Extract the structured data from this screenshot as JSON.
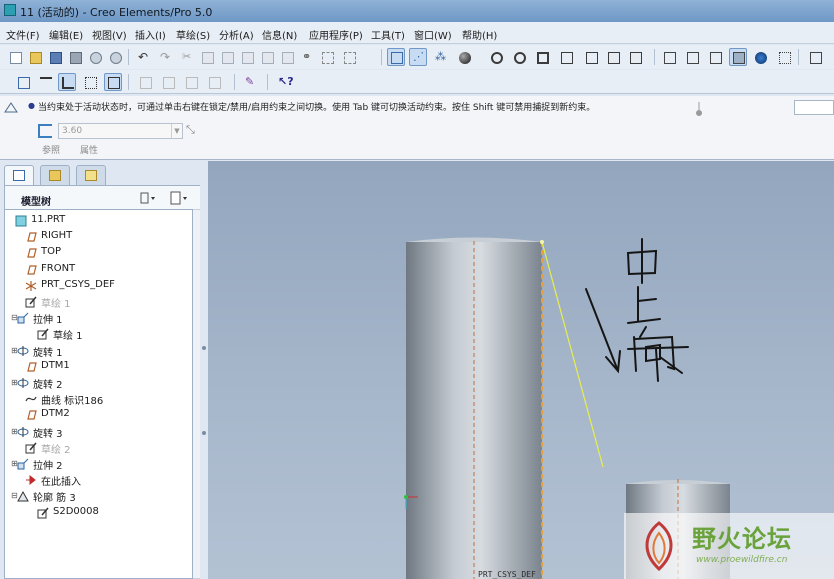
{
  "window": {
    "title": "11 (活动的) - Creo Elements/Pro 5.0"
  },
  "menu": {
    "items": [
      {
        "label": "文件(F)"
      },
      {
        "label": "编辑(E)"
      },
      {
        "label": "视图(V)"
      },
      {
        "label": "插入(I)"
      },
      {
        "label": "草绘(S)"
      },
      {
        "label": "分析(A)"
      },
      {
        "label": "信息(N)"
      },
      {
        "label": "应用程序(P)"
      },
      {
        "label": "工具(T)"
      },
      {
        "label": "窗口(W)"
      },
      {
        "label": "帮助(H)"
      }
    ]
  },
  "dashboard": {
    "message": "当约束处于活动状态时，可通过单击右键在锁定/禁用/启用约束之间切换。使用 Tab 键可切换活动约束。按住 Shift 键可禁用捕捉到新约束。",
    "dimension_value": "3.60",
    "tabs": [
      {
        "label": "参照"
      },
      {
        "label": "属性"
      }
    ]
  },
  "navigator": {
    "header": "模型树",
    "tree": [
      {
        "label": "11.PRT",
        "icon": "part-icon",
        "expand": "",
        "dim": false
      },
      {
        "label": "RIGHT",
        "icon": "datum-plane-icon",
        "expand": "",
        "dim": false
      },
      {
        "label": "TOP",
        "icon": "datum-plane-icon",
        "expand": "",
        "dim": false
      },
      {
        "label": "FRONT",
        "icon": "datum-plane-icon",
        "expand": "",
        "dim": false
      },
      {
        "label": "PRT_CSYS_DEF",
        "icon": "csys-icon",
        "expand": "",
        "dim": false
      },
      {
        "label": "草绘 1",
        "icon": "sketch-icon",
        "expand": "",
        "dim": true
      },
      {
        "label": "拉伸 1",
        "icon": "extrude-icon",
        "expand": "⊟",
        "dim": false
      },
      {
        "label": "草绘 1",
        "icon": "sketch-icon",
        "expand": "",
        "dim": false
      },
      {
        "label": "旋转 1",
        "icon": "revolve-icon",
        "expand": "⊞",
        "dim": false
      },
      {
        "label": "DTM1",
        "icon": "datum-plane-icon",
        "expand": "",
        "dim": false
      },
      {
        "label": "旋转 2",
        "icon": "revolve-icon",
        "expand": "⊞",
        "dim": false
      },
      {
        "label": "曲线 标识186",
        "icon": "curve-icon",
        "expand": "",
        "dim": false
      },
      {
        "label": "DTM2",
        "icon": "datum-plane-icon",
        "expand": "",
        "dim": false
      },
      {
        "label": "旋转 3",
        "icon": "revolve-icon",
        "expand": "⊞",
        "dim": false
      },
      {
        "label": "草绘 2",
        "icon": "sketch-icon",
        "expand": "",
        "dim": true
      },
      {
        "label": "拉伸 2",
        "icon": "extrude-icon",
        "expand": "⊞",
        "dim": false
      },
      {
        "label": "在此插入",
        "icon": "insert-here-icon",
        "expand": "",
        "dim": false
      },
      {
        "label": "轮廓 筋 3",
        "icon": "rib-icon",
        "expand": "⊟",
        "dim": false
      },
      {
        "label": "S2D0008",
        "icon": "sketch-icon",
        "expand": "",
        "dim": false
      }
    ]
  },
  "graphics": {
    "csys_label": "PRT_CSYS_DEF",
    "handwriting": "由上向下"
  },
  "watermark": {
    "title": "野火论坛",
    "url": "www.proewildfire.cn"
  },
  "colors": {
    "titlebar": "#7fa6d0",
    "graphics_bg": "#a3b4c8",
    "sketch_line": "#e8ee4a",
    "watermark_green": "#6aa33b"
  }
}
